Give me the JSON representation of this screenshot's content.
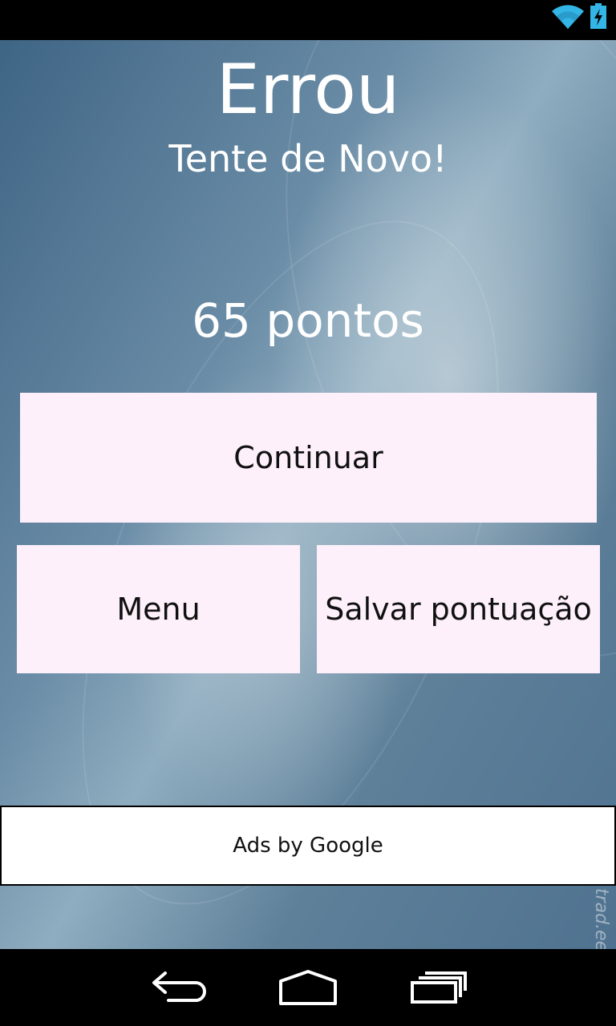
{
  "status_bar": {
    "icons": [
      "wifi-icon",
      "battery-charging-icon"
    ]
  },
  "result": {
    "title": "Errou",
    "subtitle": "Tente de Novo!",
    "score": "65 pontos"
  },
  "buttons": {
    "continue_label": "Continuar",
    "menu_label": "Menu",
    "save_label": "Salvar pontuação"
  },
  "ad": {
    "label": "Ads by Google"
  },
  "watermark": "trad.ee",
  "nav_bar": {
    "icons": [
      "back-icon",
      "home-icon",
      "recent-apps-icon"
    ]
  },
  "colors": {
    "button_background": "#fdf0fb",
    "status_bar": "#000000",
    "status_icon": "#33b5e5"
  }
}
